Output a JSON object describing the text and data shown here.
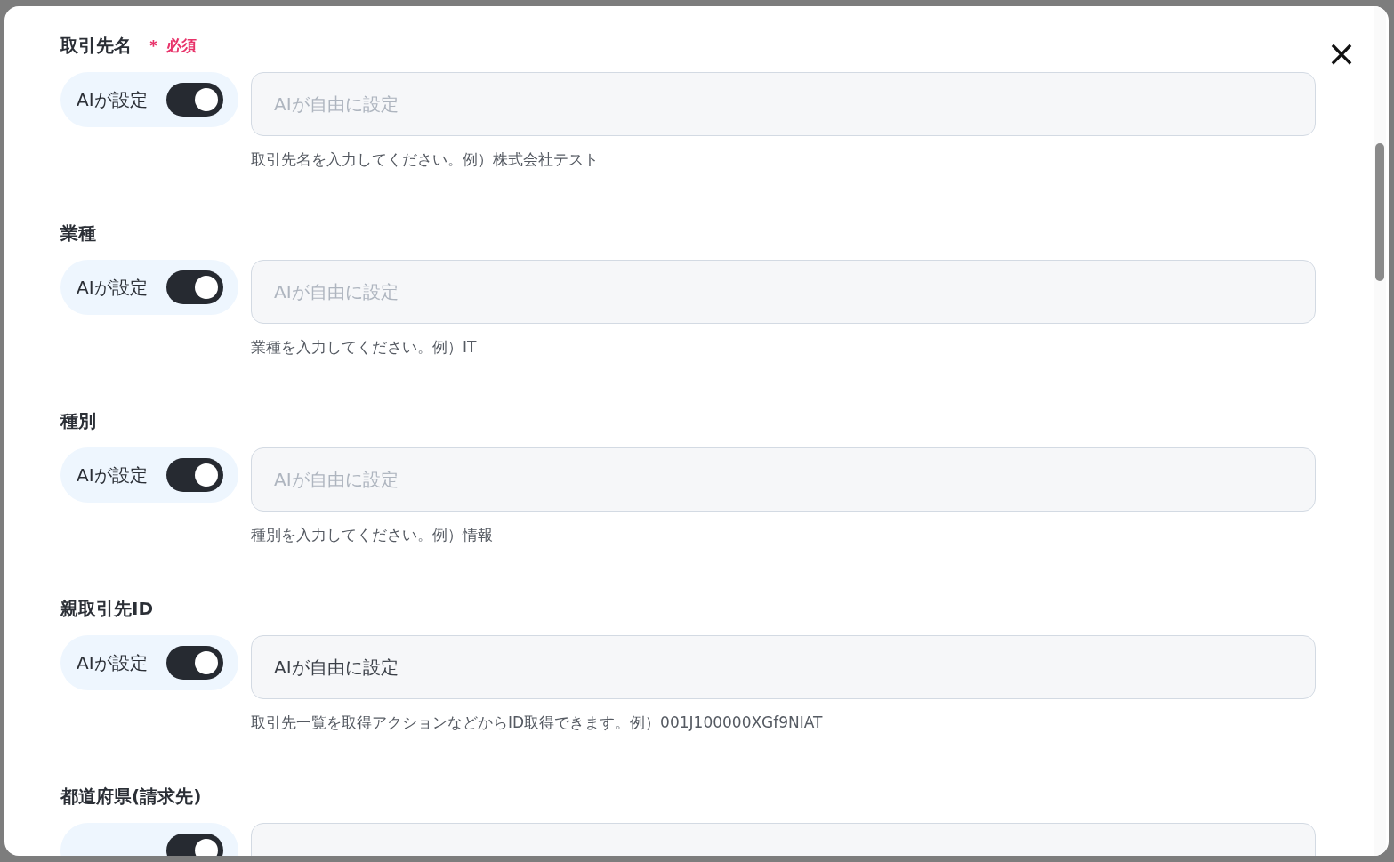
{
  "dialog": {
    "close_label": "×"
  },
  "fields": [
    {
      "label": "取引先名",
      "required_mark": "＊",
      "required_text": "必須",
      "toggle_label": "AIが設定",
      "ai_on": true,
      "placeholder": "AIが自由に設定",
      "help": "取引先名を入力してください。例）株式会社テスト"
    },
    {
      "label": "業種",
      "toggle_label": "AIが設定",
      "ai_on": true,
      "placeholder": "AIが自由に設定",
      "help": "業種を入力してください。例）IT"
    },
    {
      "label": "種別",
      "toggle_label": "AIが設定",
      "ai_on": true,
      "placeholder": "AIが自由に設定",
      "help": "種別を入力してください。例）情報"
    },
    {
      "label": "親取引先ID",
      "toggle_label": "AIが設定",
      "ai_on": true,
      "value": "AIが自由に設定",
      "help": "取引先一覧を取得アクションなどからID取得できます。例）001J100000XGf9NIAT"
    },
    {
      "label": "都道府県(請求先)",
      "ai_on": true
    }
  ]
}
